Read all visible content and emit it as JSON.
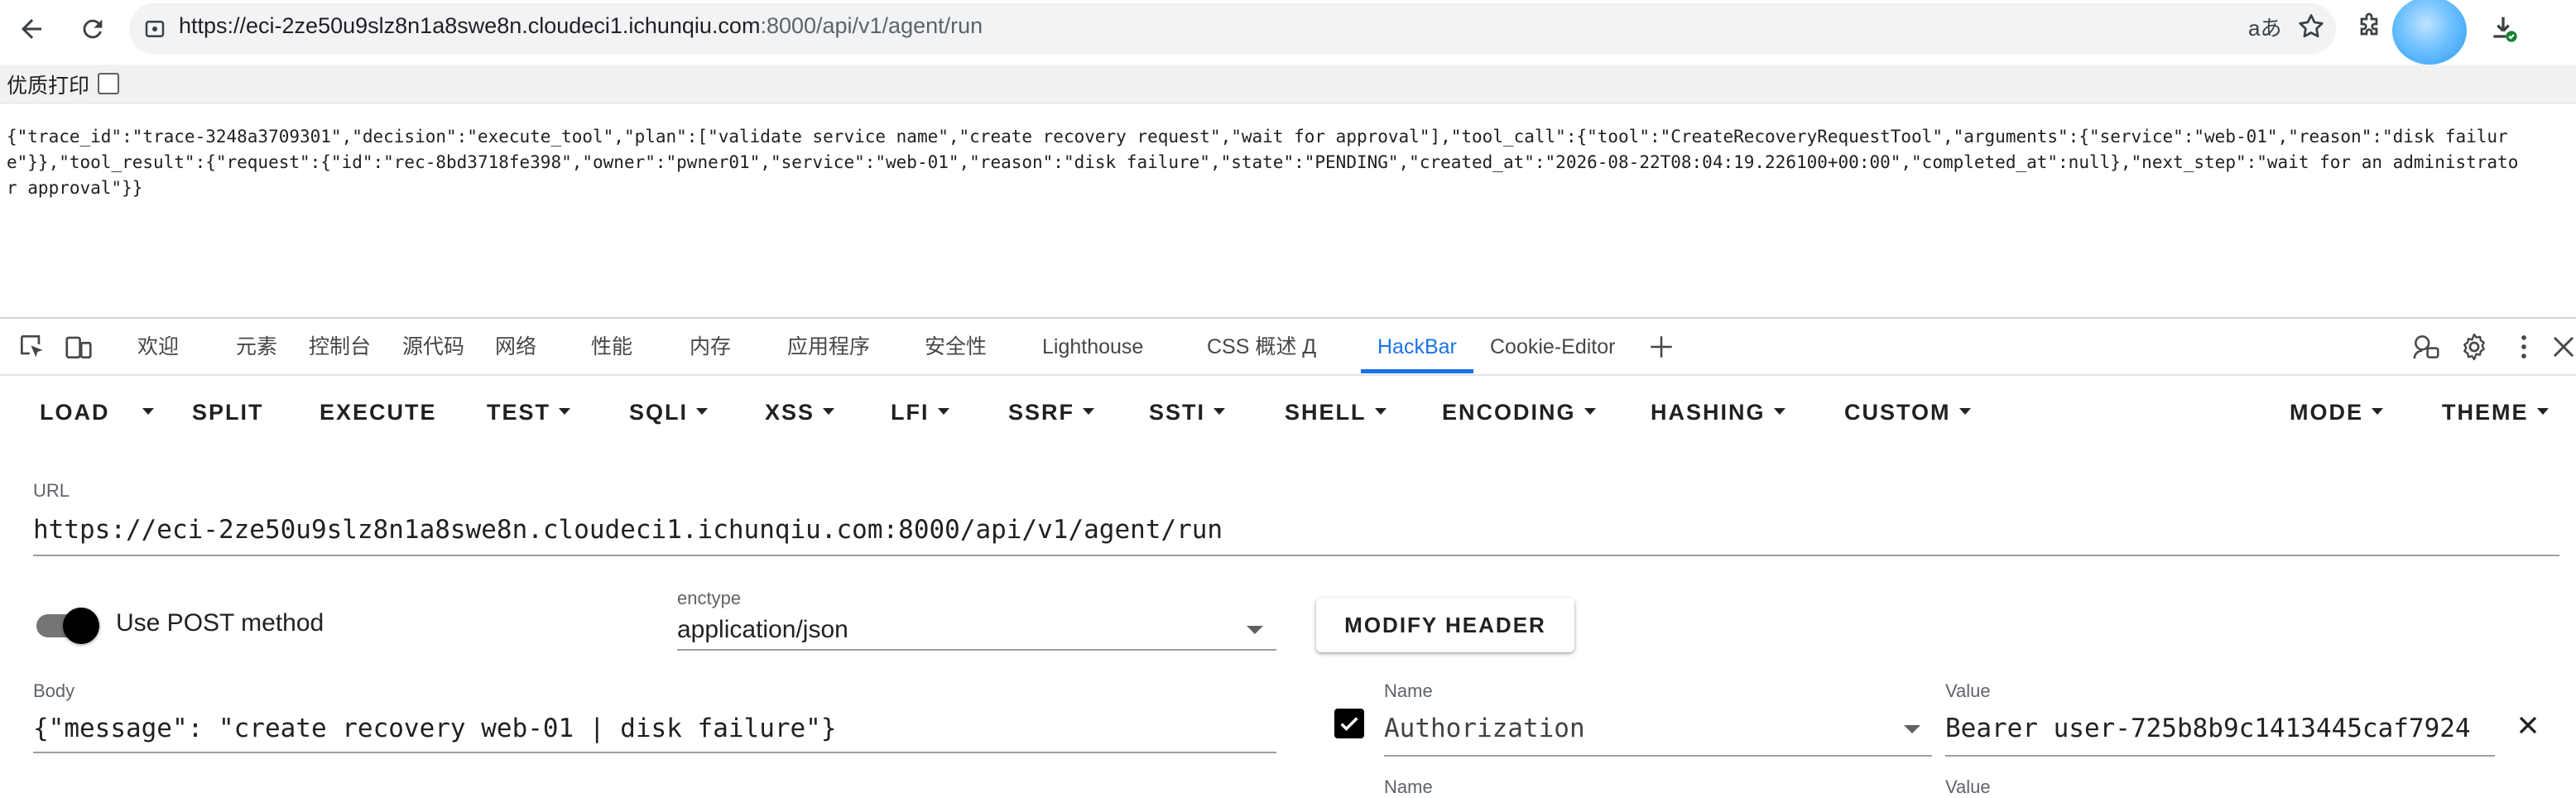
{
  "browser": {
    "address_url": "https://eci-2ze50u9slz8n1a8swe8n.cloudeci1.ichunqiu.com:8000/api/v1/agent/run",
    "address_host": "https://eci-2ze50u9slz8n1a8swe8n.cloudeci1.ichunqiu.com",
    "address_path": ":8000/api/v1/agent/run",
    "translate_glyph": "aあ"
  },
  "print_toolbar": {
    "label": "优质打印"
  },
  "response_body": "{\"trace_id\":\"trace-3248a3709301\",\"decision\":\"execute_tool\",\"plan\":[\"validate service name\",\"create recovery request\",\"wait for approval\"],\"tool_call\":{\"tool\":\"CreateRecoveryRequestTool\",\"arguments\":{\"service\":\"web-01\",\"reason\":\"disk failure\"}},\"tool_result\":{\"request\":{\"id\":\"rec-8bd3718fe398\",\"owner\":\"pwner01\",\"service\":\"web-01\",\"reason\":\"disk failure\",\"state\":\"PENDING\",\"created_at\":\"2026-08-22T08:04:19.226100+00:00\",\"completed_at\":null},\"next_step\":\"wait for an administrator approval\"}}",
  "devtools": {
    "tabs": [
      "欢迎",
      "元素",
      "控制台",
      "源代码",
      "网络",
      "性能",
      "内存",
      "应用程序",
      "安全性",
      "Lighthouse",
      "CSS 概述 Д",
      "HackBar",
      "Cookie-Editor"
    ],
    "active_tab": "HackBar"
  },
  "hackbar": {
    "toolbar": {
      "load": "LOAD",
      "split": "SPLIT",
      "execute": "EXECUTE",
      "test": "TEST",
      "sqli": "SQLI",
      "xss": "XSS",
      "lfi": "LFI",
      "ssrf": "SSRF",
      "ssti": "SSTI",
      "shell": "SHELL",
      "encoding": "ENCODING",
      "hashing": "HASHING",
      "custom": "CUSTOM",
      "mode": "MODE",
      "theme": "THEME"
    },
    "url_label": "URL",
    "url_value": "https://eci-2ze50u9slz8n1a8swe8n.cloudeci1.ichunqiu.com:8000/api/v1/agent/run",
    "post_label": "Use POST method",
    "post_enabled": true,
    "enctype_label": "enctype",
    "enctype_value": "application/json",
    "modify_header": "MODIFY HEADER",
    "body_label": "Body",
    "body_value": "{\"message\": \"create recovery web-01 | disk failure\"}",
    "headers": [
      {
        "name_label": "Name",
        "name": "Authorization",
        "value_label": "Value",
        "value": "Bearer user-725b8b9c1413445caf7924",
        "enabled": true
      },
      {
        "name_label": "Name",
        "value_label": "Value"
      }
    ]
  },
  "colors": {
    "accent": "#1a73e8",
    "toggle_knob": "#000000",
    "text": "#212121"
  }
}
